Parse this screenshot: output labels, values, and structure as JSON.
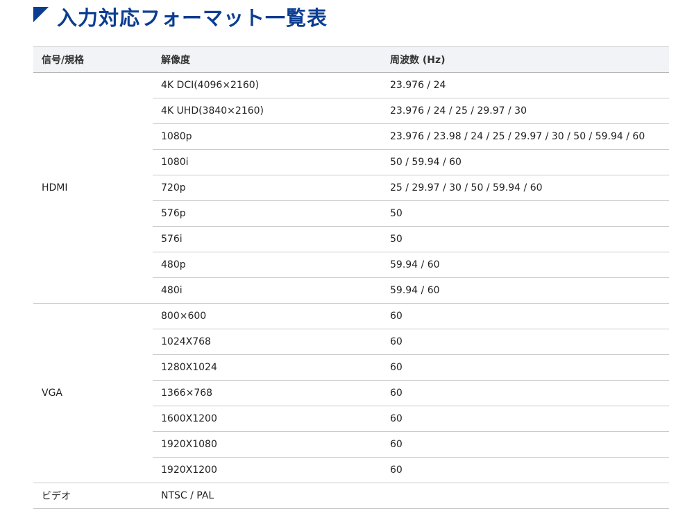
{
  "heading": {
    "title": "入力対応フォーマット一覧表",
    "accent_color": "#0b3d91",
    "icon": "corner-triangle-icon"
  },
  "table": {
    "headers": {
      "signal": "信号/規格",
      "resolution": "解像度",
      "frequency": "周波数 (Hz)"
    },
    "groups": [
      {
        "signal": "HDMI",
        "rows": [
          {
            "resolution": "4K DCI(4096×2160)",
            "frequency": "23.976 / 24"
          },
          {
            "resolution": "4K UHD(3840×2160)",
            "frequency": "23.976 / 24 / 25 / 29.97 / 30"
          },
          {
            "resolution": "1080p",
            "frequency": "23.976 / 23.98 / 24 / 25 / 29.97 / 30 / 50 / 59.94 / 60"
          },
          {
            "resolution": "1080i",
            "frequency": "50 / 59.94 / 60"
          },
          {
            "resolution": "720p",
            "frequency": "25 / 29.97 / 30 / 50 / 59.94 / 60"
          },
          {
            "resolution": "576p",
            "frequency": "50"
          },
          {
            "resolution": "576i",
            "frequency": "50"
          },
          {
            "resolution": "480p",
            "frequency": "59.94 / 60"
          },
          {
            "resolution": "480i",
            "frequency": "59.94 / 60"
          }
        ]
      },
      {
        "signal": "VGA",
        "rows": [
          {
            "resolution": "800×600",
            "frequency": "60"
          },
          {
            "resolution": "1024X768",
            "frequency": "60"
          },
          {
            "resolution": "1280X1024",
            "frequency": "60"
          },
          {
            "resolution": "1366×768",
            "frequency": "60"
          },
          {
            "resolution": "1600X1200",
            "frequency": "60"
          },
          {
            "resolution": "1920X1080",
            "frequency": "60"
          },
          {
            "resolution": "1920X1200",
            "frequency": "60"
          }
        ]
      },
      {
        "signal": "ビデオ",
        "rows": [
          {
            "resolution": "NTSC / PAL",
            "frequency": ""
          }
        ]
      }
    ]
  }
}
